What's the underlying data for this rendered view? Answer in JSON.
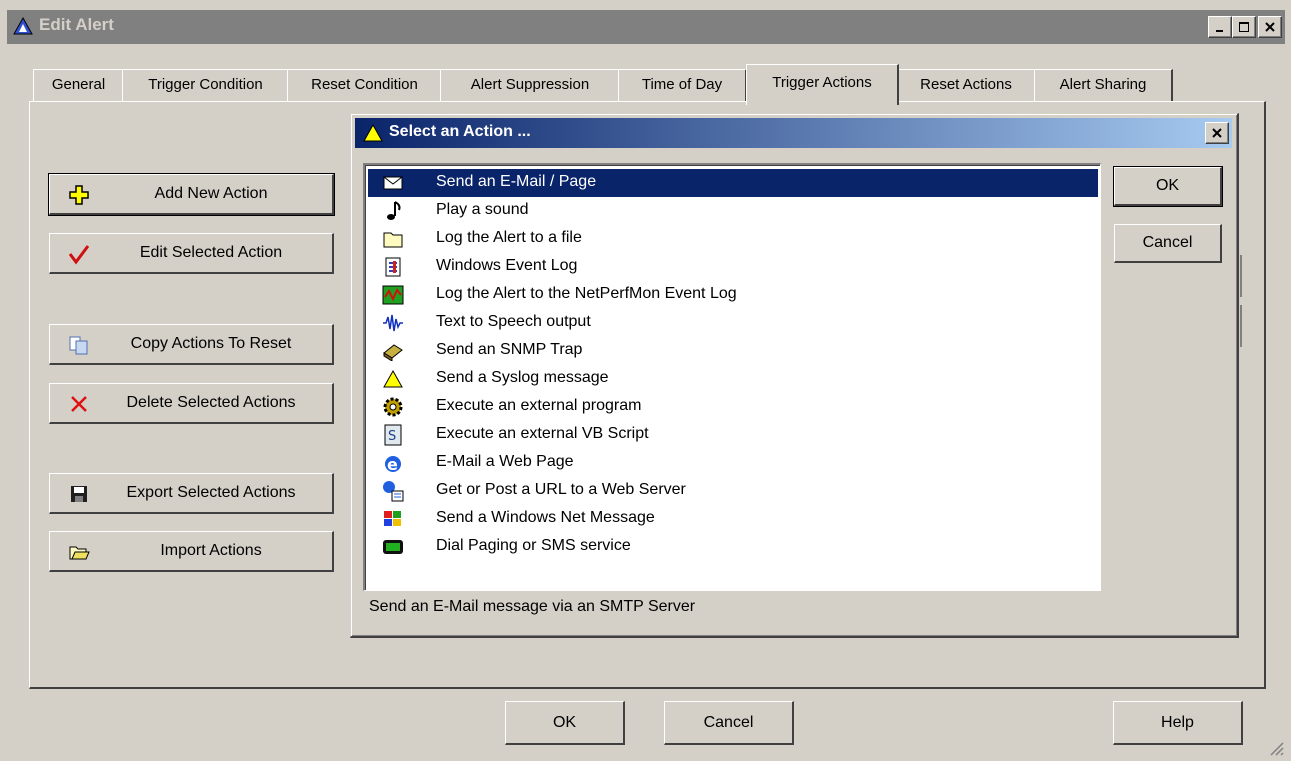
{
  "window": {
    "title": "Edit Alert"
  },
  "tabs": [
    {
      "label": "General"
    },
    {
      "label": "Trigger Condition"
    },
    {
      "label": "Reset Condition"
    },
    {
      "label": "Alert Suppression"
    },
    {
      "label": "Time of Day"
    },
    {
      "label": "Trigger Actions",
      "active": true
    },
    {
      "label": "Reset Actions"
    },
    {
      "label": "Alert Sharing"
    }
  ],
  "side_buttons": [
    {
      "label": "Add New Action",
      "icon": "plus-icon"
    },
    {
      "label": "Edit Selected Action",
      "icon": "checkmark-icon"
    },
    {
      "label": "Copy Actions To Reset",
      "icon": "copy-icon"
    },
    {
      "label": "Delete Selected Actions",
      "icon": "delete-icon"
    },
    {
      "label": "Export Selected Actions",
      "icon": "save-icon"
    },
    {
      "label": "Import Actions",
      "icon": "open-folder-icon"
    }
  ],
  "dialog": {
    "title": "Select an Action ...",
    "ok_label": "OK",
    "cancel_label": "Cancel",
    "description": "Send an E-Mail message via an SMTP Server",
    "actions": [
      {
        "label": "Send an E-Mail / Page",
        "icon": "envelope-icon",
        "selected": true
      },
      {
        "label": "Play a sound",
        "icon": "music-note-icon"
      },
      {
        "label": "Log the Alert to a file",
        "icon": "folder-icon"
      },
      {
        "label": "Windows Event Log",
        "icon": "event-log-icon"
      },
      {
        "label": "Log the Alert to the NetPerfMon Event Log",
        "icon": "netperfmon-icon"
      },
      {
        "label": "Text to Speech output",
        "icon": "waveform-icon"
      },
      {
        "label": "Send an SNMP Trap",
        "icon": "snmp-icon"
      },
      {
        "label": "Send a Syslog message",
        "icon": "warning-triangle-icon"
      },
      {
        "label": "Execute an external program",
        "icon": "gear-icon"
      },
      {
        "label": "Execute an external VB Script",
        "icon": "script-icon"
      },
      {
        "label": "E-Mail a Web Page",
        "icon": "internet-explorer-icon"
      },
      {
        "label": "Get or Post a URL to a Web Server",
        "icon": "web-server-icon"
      },
      {
        "label": "Send a Windows Net Message",
        "icon": "windows-message-icon"
      },
      {
        "label": "Dial Paging or SMS service",
        "icon": "pager-icon"
      }
    ]
  },
  "footer": {
    "ok_label": "OK",
    "cancel_label": "Cancel",
    "help_label": "Help"
  }
}
